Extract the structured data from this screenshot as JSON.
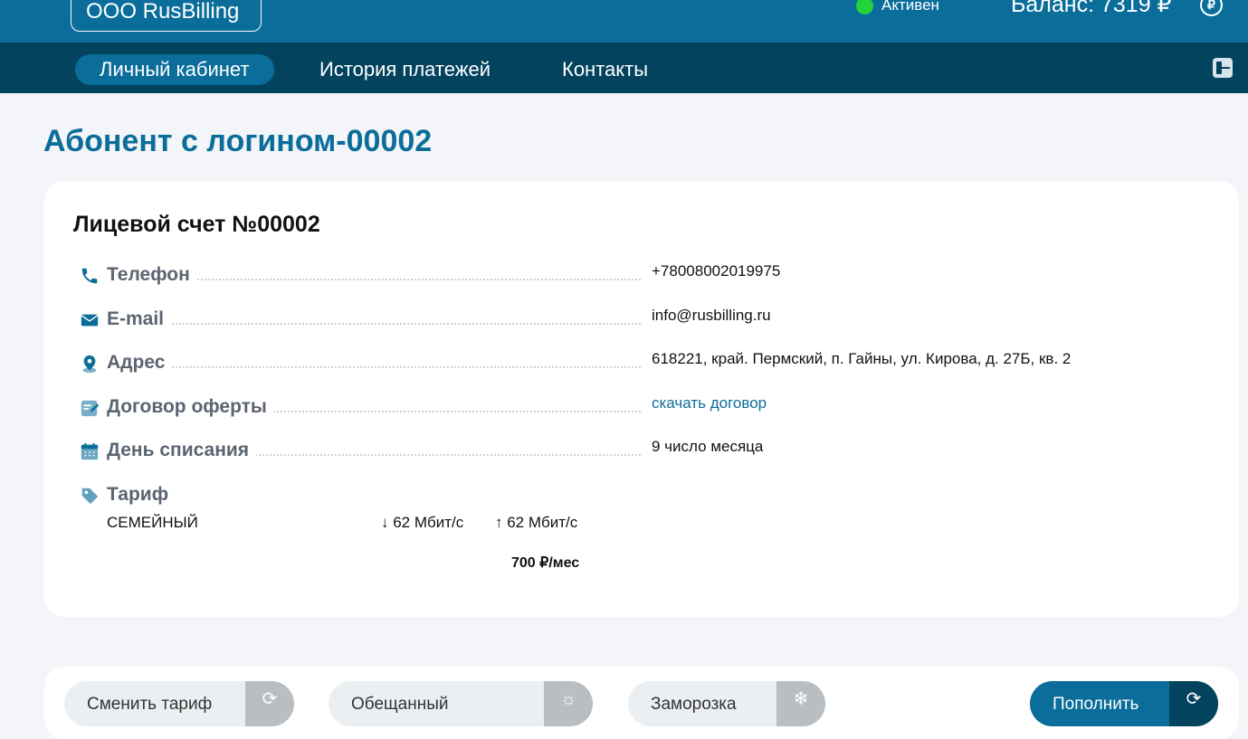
{
  "header": {
    "brand": "ООО RusBilling",
    "status": "Активен",
    "balance": "Баланс: 7319 ₽",
    "ruble_icon": "₽"
  },
  "nav": {
    "items": [
      {
        "label": "Личный кабинет",
        "active": true
      },
      {
        "label": "История платежей",
        "active": false
      },
      {
        "label": "Контакты",
        "active": false
      }
    ],
    "logout_icon": "logout-icon"
  },
  "page": {
    "title": "Абонент с логином-00002"
  },
  "account": {
    "title": "Лицевой счет №00002",
    "rows": [
      {
        "icon": "phone-icon",
        "label": "Телефон",
        "value": "+78008002019975"
      },
      {
        "icon": "mail-icon",
        "label": "E-mail",
        "value": "info@rusbilling.ru"
      },
      {
        "icon": "location-icon",
        "label": "Адрес",
        "value": "618221, край. Пермский, п. Гайны, ул. Кирова, д. 27Б, кв. 2"
      },
      {
        "icon": "contract-icon",
        "label": "Договор оферты",
        "value": "скачать договор"
      },
      {
        "icon": "calendar-icon",
        "label": "День списания",
        "value": "9 число месяца"
      }
    ],
    "tariff": {
      "icon": "tag-icon",
      "label": "Тариф",
      "name": "СЕМЕЙНЫЙ",
      "speed_down": "↓ 62 Мбит/с",
      "speed_up": "↑ 62 Мбит/с",
      "price": "700 ₽/мес"
    }
  },
  "actions": {
    "buttons": [
      {
        "label": "Сменить тариф",
        "icon": "refresh-icon"
      },
      {
        "label": "Обещанный",
        "icon": "sun-icon"
      },
      {
        "label": "Заморозка",
        "icon": "snowflake-icon"
      },
      {
        "label": "Пополнить",
        "icon": "payment-icon"
      }
    ]
  },
  "colors": {
    "header_bg": "#0a6d9a",
    "nav_bg": "#03435e",
    "accent": "#0a6d9a",
    "status_green": "#22d33b"
  }
}
